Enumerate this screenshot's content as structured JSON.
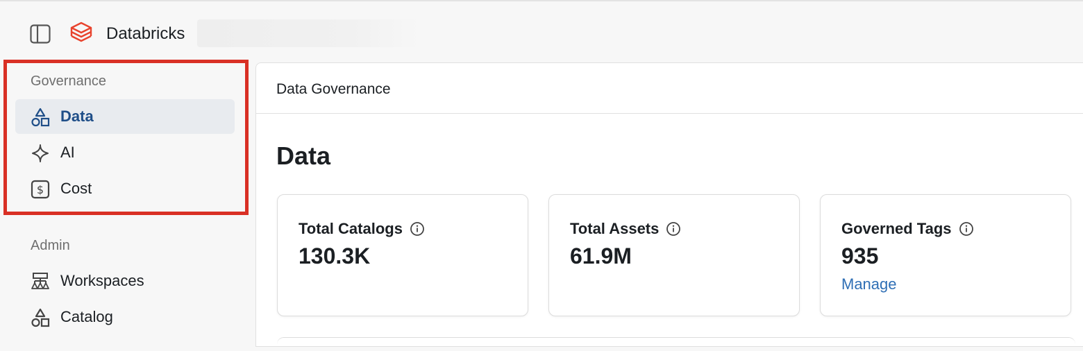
{
  "header": {
    "brand": "Databricks",
    "icons": {
      "panel_toggle": "sidebar-panel-icon",
      "logo": "databricks-logo-icon"
    },
    "logo_color": "#e8432d"
  },
  "sidebar": {
    "sections": [
      {
        "label": "Governance",
        "items": [
          {
            "label": "Data",
            "icon": "shapes-icon",
            "active": true
          },
          {
            "label": "AI",
            "icon": "ai-sparkle-icon",
            "active": false
          },
          {
            "label": "Cost",
            "icon": "dollar-icon",
            "active": false
          }
        ]
      },
      {
        "label": "Admin",
        "items": [
          {
            "label": "Workspaces",
            "icon": "workspaces-icon",
            "active": false
          },
          {
            "label": "Catalog",
            "icon": "shapes-icon",
            "active": false
          }
        ]
      }
    ],
    "highlight_color": "#d93025",
    "active_color": "#1f4e88"
  },
  "main": {
    "breadcrumb": "Data Governance",
    "title": "Data",
    "cards": [
      {
        "title": "Total Catalogs",
        "value": "130.3K",
        "icon": "info-icon"
      },
      {
        "title": "Total Assets",
        "value": "61.9M",
        "icon": "info-icon"
      },
      {
        "title": "Governed Tags",
        "value": "935",
        "icon": "info-icon",
        "link": "Manage"
      }
    ],
    "link_color": "#2f6fb5"
  }
}
